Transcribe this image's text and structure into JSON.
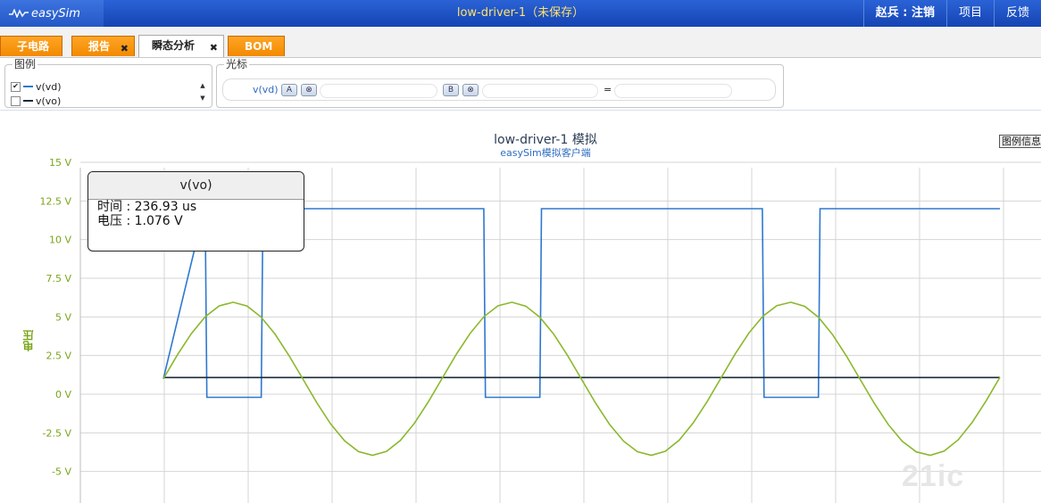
{
  "app": {
    "logo_text": "easySim",
    "title": "low-driver-1（未保存）",
    "user": "赵兵 : 注销",
    "menu_project": "项目",
    "menu_feedback": "反馈"
  },
  "tabs": [
    {
      "label": "子电路",
      "active": false,
      "closable": false
    },
    {
      "label": "报告",
      "active": false,
      "closable": true
    },
    {
      "label": "瞬态分析",
      "active": true,
      "closable": true
    },
    {
      "label": "BOM",
      "active": false,
      "closable": false
    }
  ],
  "legend_panel": {
    "title": "图例",
    "items": [
      {
        "label": "v(vd)",
        "checked": true,
        "color": "#2e78d0"
      },
      {
        "label": "v(vo)",
        "checked": false,
        "color": "#1a2a3a"
      }
    ]
  },
  "cursor_panel": {
    "title": "光标",
    "signal": "v(vd)",
    "btn_a": "A",
    "btn_b": "B",
    "clear_icon": "⊗",
    "equals": "="
  },
  "chart_data": {
    "type": "line",
    "title": "low-driver-1 模拟",
    "subtitle": "easySim模拟客户端",
    "ylabel": "电压",
    "legend_button": "图例信息",
    "yticks": [
      "15 V",
      "12.5 V",
      "10 V",
      "7.5 V",
      "5 V",
      "2.5 V",
      "0 V",
      "-2.5 V",
      "-5 V"
    ],
    "ylim": [
      -6.5,
      15
    ],
    "xlim": [
      0,
      1
    ],
    "series": [
      {
        "color": "#2e78d0",
        "kind": "square",
        "high": 12,
        "low": -0.2,
        "start_high": 0.09,
        "period": 0.333,
        "low_width": 0.067
      },
      {
        "color": "#1a2a3a",
        "kind": "constant",
        "value": 1.076
      },
      {
        "color": "#8ab82c",
        "kind": "sine",
        "offset": 1,
        "amplitude": 4.95,
        "period": 0.333
      }
    ]
  },
  "tooltip": {
    "title": "v(vo)",
    "time": "时间 : 236.93 us",
    "voltage": "电压 : 1.076 V"
  }
}
